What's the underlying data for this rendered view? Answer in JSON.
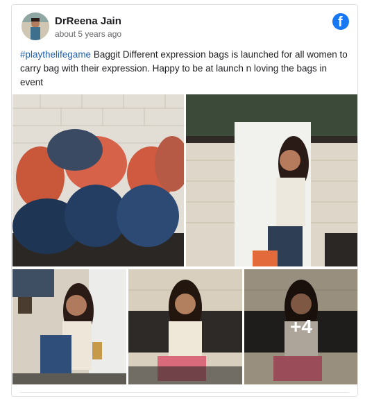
{
  "post": {
    "author": "DrReena Jain",
    "time": "about 5 years ago",
    "hashtag": "#playthelifegame",
    "text": " Baggit Different expression bags is launched for all women to carry bag with their expression. Happy to be at launch n loving the bags in event",
    "more_photos": "+4"
  },
  "icons": {
    "platform": "facebook-icon"
  },
  "colors": {
    "facebook_blue": "#1877f2",
    "hashtag": "#2261b0"
  }
}
